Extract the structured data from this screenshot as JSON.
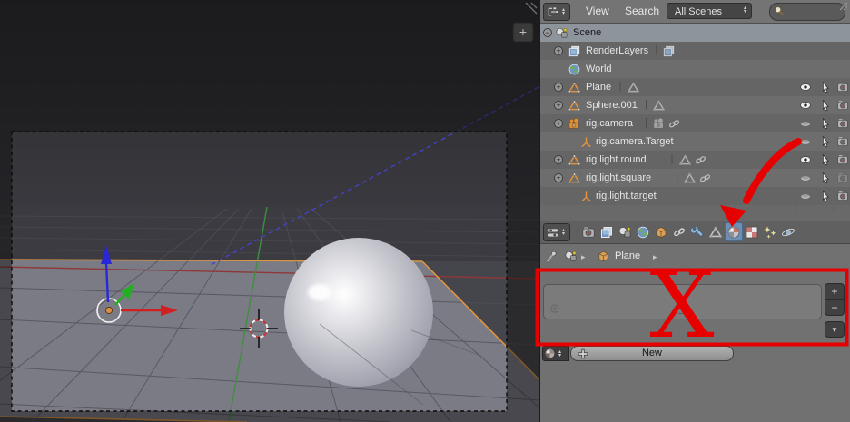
{
  "viewport": {
    "plus_label": "+",
    "objects_shown": [
      "plane-grid",
      "sphere",
      "transform-manipulator",
      "3d-cursor",
      "camera-frame"
    ]
  },
  "outliner": {
    "header": {
      "menus": [
        "View",
        "Search"
      ],
      "scene_filter": "All Scenes",
      "search_placeholder": ""
    },
    "rows": [
      {
        "label": "Scene",
        "indent": 0,
        "expander": "minus",
        "icon": "scene",
        "selected": true,
        "pipe": false,
        "data_icons": [],
        "eye": null,
        "select_arrow": false,
        "render": null
      },
      {
        "label": "RenderLayers",
        "indent": 1,
        "expander": "plus",
        "icon": "renderlayers",
        "selected": false,
        "pipe": true,
        "data_icons": [
          "renderlayers"
        ],
        "eye": null,
        "select_arrow": false,
        "render": null
      },
      {
        "label": "World",
        "indent": 1,
        "expander": "none",
        "icon": "world",
        "selected": false,
        "pipe": false,
        "data_icons": [],
        "eye": null,
        "select_arrow": false,
        "render": null
      },
      {
        "label": "Plane",
        "indent": 1,
        "expander": "plus",
        "icon": "mesh",
        "selected": false,
        "pipe": true,
        "data_icons": [
          "meshdata"
        ],
        "eye": "open",
        "select_arrow": true,
        "render": "on"
      },
      {
        "label": "Sphere.001",
        "indent": 1,
        "expander": "plus",
        "icon": "mesh",
        "selected": false,
        "pipe": true,
        "data_icons": [
          "meshdata"
        ],
        "eye": "open",
        "select_arrow": true,
        "render": "on"
      },
      {
        "label": "rig.camera",
        "indent": 1,
        "expander": "plus",
        "icon": "camera",
        "selected": false,
        "pipe": true,
        "data_icons": [
          "cameradata",
          "link"
        ],
        "eye": "closed",
        "select_arrow": true,
        "render": "on"
      },
      {
        "label": "rig.camera.Target",
        "indent": 2,
        "expander": "none",
        "icon": "empty",
        "selected": false,
        "pipe": false,
        "data_icons": [],
        "eye": "closed",
        "select_arrow": true,
        "render": "on"
      },
      {
        "label": "rig.light.round",
        "indent": 1,
        "expander": "plus",
        "icon": "mesh",
        "selected": false,
        "pipe": true,
        "data_icons": [
          "meshdata",
          "link"
        ],
        "eye": "open",
        "select_arrow": true,
        "render": "on"
      },
      {
        "label": "rig.light.square",
        "indent": 1,
        "expander": "plus",
        "icon": "mesh",
        "selected": false,
        "pipe": true,
        "data_icons": [
          "meshdata",
          "link"
        ],
        "eye": "closed",
        "select_arrow": true,
        "render": "dim"
      },
      {
        "label": "rig.light.target",
        "indent": 2,
        "expander": "none",
        "icon": "empty",
        "selected": false,
        "pipe": false,
        "data_icons": [],
        "eye": "closed",
        "select_arrow": true,
        "render": "on"
      }
    ]
  },
  "properties": {
    "tabs": [
      {
        "name": "render",
        "active": false
      },
      {
        "name": "renderlayers",
        "active": false
      },
      {
        "name": "scene",
        "active": false
      },
      {
        "name": "world",
        "active": false
      },
      {
        "name": "object",
        "active": false
      },
      {
        "name": "constraints",
        "active": false
      },
      {
        "name": "modifiers",
        "active": false
      },
      {
        "name": "object-data",
        "active": false
      },
      {
        "name": "material",
        "active": true
      },
      {
        "name": "texture",
        "active": false
      },
      {
        "name": "particles",
        "active": false
      },
      {
        "name": "physics",
        "active": false
      }
    ],
    "breadcrumb": {
      "object": "Plane"
    },
    "material_slots": {
      "add": "+",
      "remove": "−",
      "specials": "▼"
    },
    "new_button": {
      "label": "New"
    }
  },
  "annotation": {
    "x_label": "X",
    "color": "#e60000",
    "notes": [
      "arrow-pointing-to-material-tab",
      "box-around-empty-material-slot-list"
    ]
  },
  "colors": {
    "annotation_red": "#e60000",
    "tab_active_blue": "#6d8fb5",
    "selected_row": "#8d949c",
    "object_orange": "#e0923c"
  }
}
